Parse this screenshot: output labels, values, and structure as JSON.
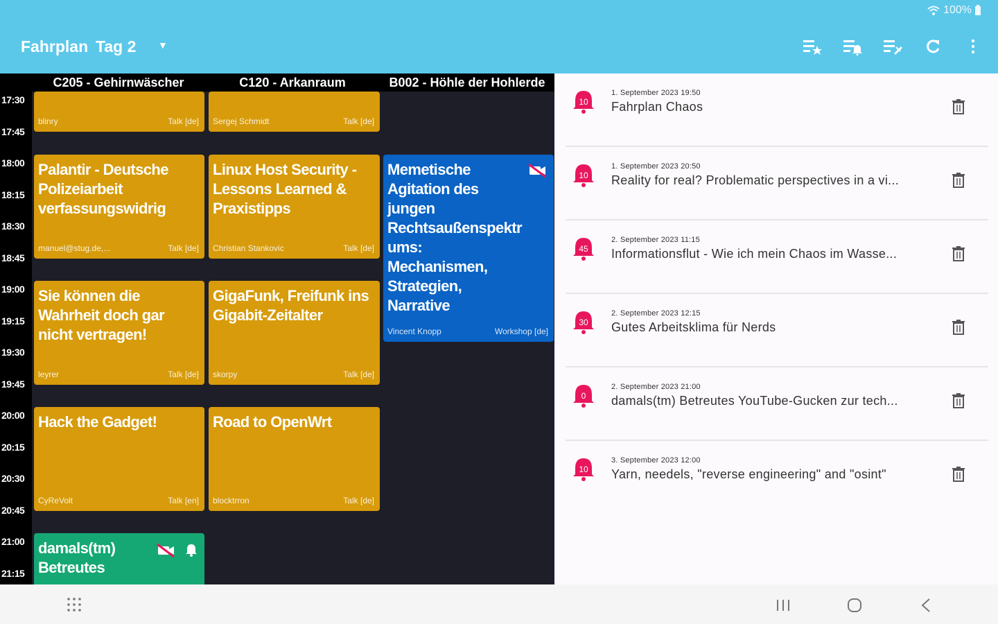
{
  "status": {
    "battery": "100%"
  },
  "appbar": {
    "title": "Fahrplan",
    "day": "Tag 2",
    "actions": [
      "favorites-list-icon",
      "alarms-list-icon",
      "change-log-icon",
      "refresh-icon",
      "more-vert-icon"
    ]
  },
  "schedule": {
    "rooms": [
      "C205 - Gehirnwäscher",
      "C120 - Arkanraum",
      "B002 - Höhle der Hohlerde"
    ],
    "times": [
      "17:30",
      "17:45",
      "18:00",
      "18:15",
      "18:30",
      "18:45",
      "19:00",
      "19:15",
      "19:30",
      "19:45",
      "20:00",
      "20:15",
      "20:30",
      "20:45",
      "21:00",
      "21:15"
    ],
    "events": [
      {
        "title": "",
        "speaker": "blinry",
        "type": "Talk [de]"
      },
      {
        "title": "",
        "speaker": "Sergej Schmidt",
        "type": "Talk [de]"
      },
      {
        "title": "Palantir - Deutsche Polizeiarbeit verfassungswidrig",
        "speaker": "manuel@stug.de,...",
        "type": "Talk [de]"
      },
      {
        "title": "Linux Host Security - Lessons Learned & Praxistipps",
        "speaker": "Christian Stankovic",
        "type": "Talk [de]"
      },
      {
        "title": "Memetische Agitation des jungen Rechtsaußenspektr ums: Mechanismen, Strategien, Narrative",
        "speaker": "Vincent Knopp",
        "type": "Workshop [de]"
      },
      {
        "title": "Sie können die Wahrheit doch gar nicht vertragen!",
        "speaker": "leyrer",
        "type": "Talk [de]"
      },
      {
        "title": "GigaFunk, Freifunk ins Gigabit-Zeitalter",
        "speaker": "skorpy",
        "type": "Talk [de]"
      },
      {
        "title": "Hack the Gadget!",
        "speaker": "CyReVolt",
        "type": "Talk [en]"
      },
      {
        "title": "Road to OpenWrt",
        "speaker": "blocktrron",
        "type": "Talk [de]"
      },
      {
        "title": "damals(tm) Betreutes",
        "speaker": "",
        "type": ""
      }
    ]
  },
  "alarms": [
    {
      "badge": "10",
      "date": "1. September 2023 19:50",
      "title": "Fahrplan Chaos"
    },
    {
      "badge": "10",
      "date": "1. September 2023 20:50",
      "title": "Reality for real? Problematic perspectives in a vi..."
    },
    {
      "badge": "45",
      "date": "2. September 2023 11:15",
      "title": "Informationsflut - Wie ich mein Chaos im Wasse..."
    },
    {
      "badge": "30",
      "date": "2. September 2023 12:15",
      "title": "Gutes Arbeitsklima für Nerds"
    },
    {
      "badge": "0",
      "date": "2. September 2023 21:00",
      "title": "damals(tm) Betreutes YouTube-Gucken zur tech..."
    },
    {
      "badge": "10",
      "date": "3. September 2023 12:00",
      "title": "Yarn, needels, \"reverse engineering\" and \"osint\""
    }
  ],
  "colors": {
    "appbar": "#5bc8ea",
    "talk": "#d79b0b",
    "workshop": "#0a63c5",
    "alarm": "#e8175d",
    "highlight": "#15a874"
  }
}
